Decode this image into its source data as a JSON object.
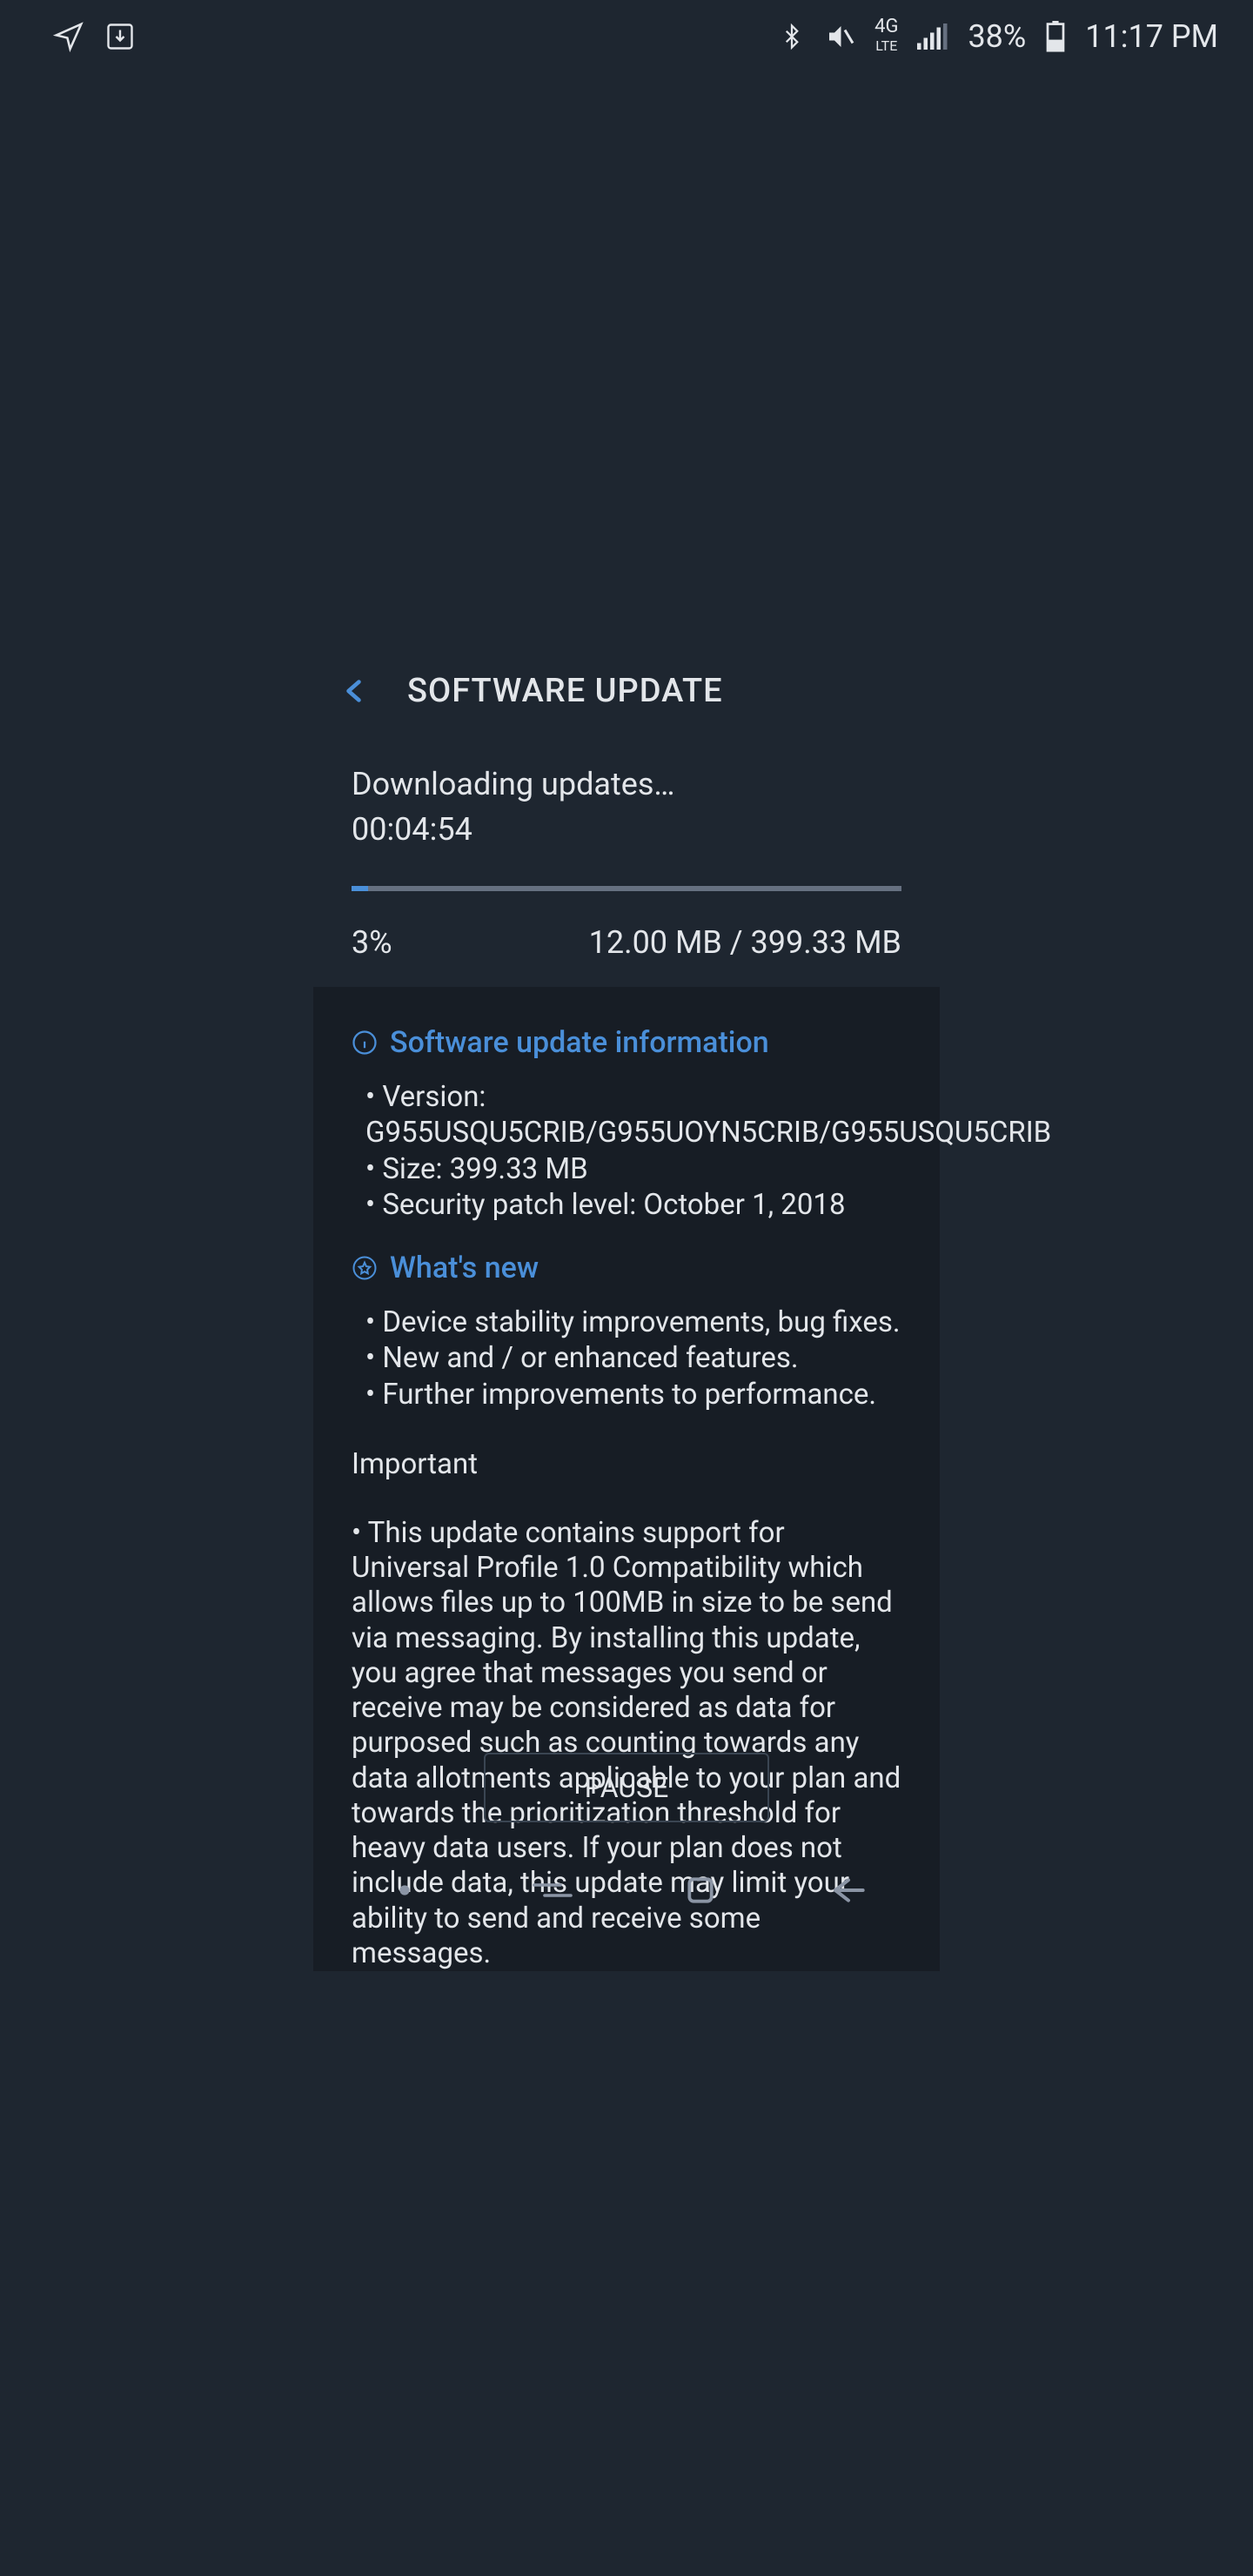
{
  "status_bar": {
    "battery_percent": "38%",
    "time": "11:17 PM"
  },
  "header": {
    "title": "SOFTWARE UPDATE"
  },
  "download": {
    "status": "Downloading updates…",
    "time_remaining": "00:04:54",
    "percent": "3%",
    "progress_pct": 3,
    "size_done": "12.00 MB",
    "size_total": "399.33 MB"
  },
  "info": {
    "title": "Software update information",
    "version_label": "Version:",
    "version_value": "G955USQU5CRIB/G955UOYN5CRIB/G955USQU5CRIB",
    "size_label": "Size:",
    "size_value": "399.33 MB",
    "patch_label": "Security patch level:",
    "patch_value": "October 1, 2018"
  },
  "whats_new": {
    "title": "What's new",
    "items": [
      "Device stability improvements, bug fixes.",
      "New and / or enhanced features.",
      "Further improvements to performance."
    ],
    "important_title": "Important",
    "important_body": "• This update contains support for Universal Profile 1.0 Compatibility which allows files up to 100MB in size to be send via messaging. By installing this update, you agree that messages you send or receive may be considered as data for purposed such as counting towards any data allotments applicable to your plan and towards the prioritization threshold for heavy data users. If your plan does not include data, this update may limit your ability to send and receive some messages."
  },
  "buttons": {
    "pause": "PAUSE"
  }
}
